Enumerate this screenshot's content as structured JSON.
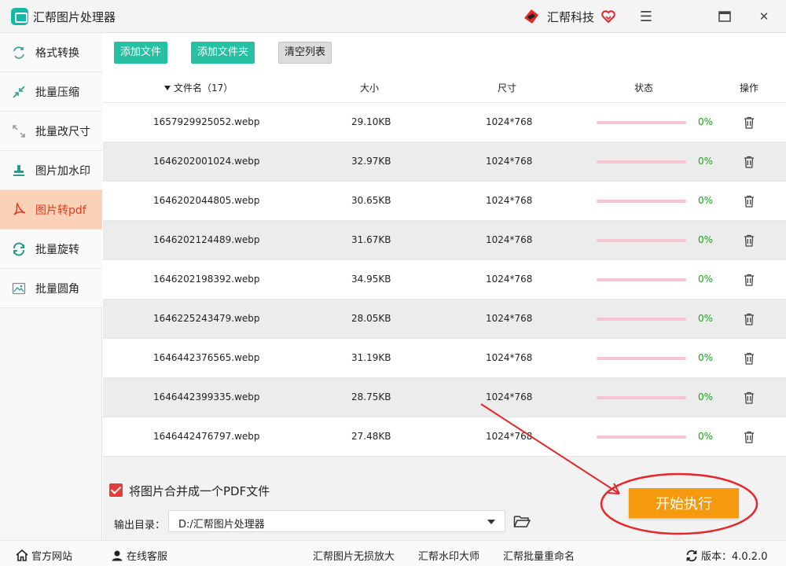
{
  "window": {
    "title": "汇帮图片处理器",
    "brand_name": "汇帮科技",
    "icons": {
      "logo": "app-logo-icon",
      "brand": "brand-logo-icon",
      "heart": "heart-icon",
      "menu": "menu-icon",
      "maximize": "maximize-icon",
      "close": "close-icon"
    },
    "menu_glyph": "☰",
    "close_glyph": "✕"
  },
  "sidebar": {
    "items": [
      {
        "label": "格式转换",
        "icon": "format-convert-icon"
      },
      {
        "label": "批量压缩",
        "icon": "compress-icon"
      },
      {
        "label": "批量改尺寸",
        "icon": "resize-icon"
      },
      {
        "label": "图片加水印",
        "icon": "watermark-icon"
      },
      {
        "label": "图片转pdf",
        "icon": "pdf-icon",
        "active": true
      },
      {
        "label": "批量旋转",
        "icon": "rotate-icon"
      },
      {
        "label": "批量圆角",
        "icon": "rounded-corner-icon"
      }
    ]
  },
  "toolbar": {
    "add_file": "添加文件",
    "add_folder": "添加文件夹",
    "clear_list": "清空列表"
  },
  "table": {
    "headers": {
      "name": "文件名（17）",
      "size": "大小",
      "dimensions": "尺寸",
      "status": "状态",
      "action": "操作"
    },
    "rows": [
      {
        "name": "1657929925052.webp",
        "size": "29.10KB",
        "dimensions": "1024*768",
        "progress": "0%"
      },
      {
        "name": "1646202001024.webp",
        "size": "32.97KB",
        "dimensions": "1024*768",
        "progress": "0%"
      },
      {
        "name": "1646202044805.webp",
        "size": "30.65KB",
        "dimensions": "1024*768",
        "progress": "0%"
      },
      {
        "name": "1646202124489.webp",
        "size": "31.67KB",
        "dimensions": "1024*768",
        "progress": "0%"
      },
      {
        "name": "1646202198392.webp",
        "size": "34.95KB",
        "dimensions": "1024*768",
        "progress": "0%"
      },
      {
        "name": "1646225243479.webp",
        "size": "28.05KB",
        "dimensions": "1024*768",
        "progress": "0%"
      },
      {
        "name": "1646442376565.webp",
        "size": "31.19KB",
        "dimensions": "1024*768",
        "progress": "0%"
      },
      {
        "name": "1646442399335.webp",
        "size": "28.75KB",
        "dimensions": "1024*768",
        "progress": "0%"
      },
      {
        "name": "1646442476797.webp",
        "size": "27.48KB",
        "dimensions": "1024*768",
        "progress": "0%"
      }
    ]
  },
  "options": {
    "merge_label": "将图片合并成一个PDF文件",
    "merge_checked": true,
    "output_label": "输出目录：",
    "output_value": "D:/汇帮图片处理器",
    "start_button": "开始执行"
  },
  "colors": {
    "accent_green": "#25c1a2",
    "active_bg": "#fbd2b8",
    "active_text": "#e03a1c",
    "start_orange": "#f59a0e",
    "annotation_red": "#e8252b",
    "progress_pink": "#f6c5d1",
    "progress_text_green": "#1aa51a"
  },
  "footer": {
    "links": [
      {
        "label": "官方网站",
        "icon": "home-icon"
      },
      {
        "label": "在线客服",
        "icon": "support-icon"
      },
      {
        "label": "汇帮图片无损放大"
      },
      {
        "label": "汇帮水印大师"
      },
      {
        "label": "汇帮批量重命名"
      }
    ],
    "version_label": "版本：4.0.2.0",
    "version_icon": "refresh-icon"
  }
}
